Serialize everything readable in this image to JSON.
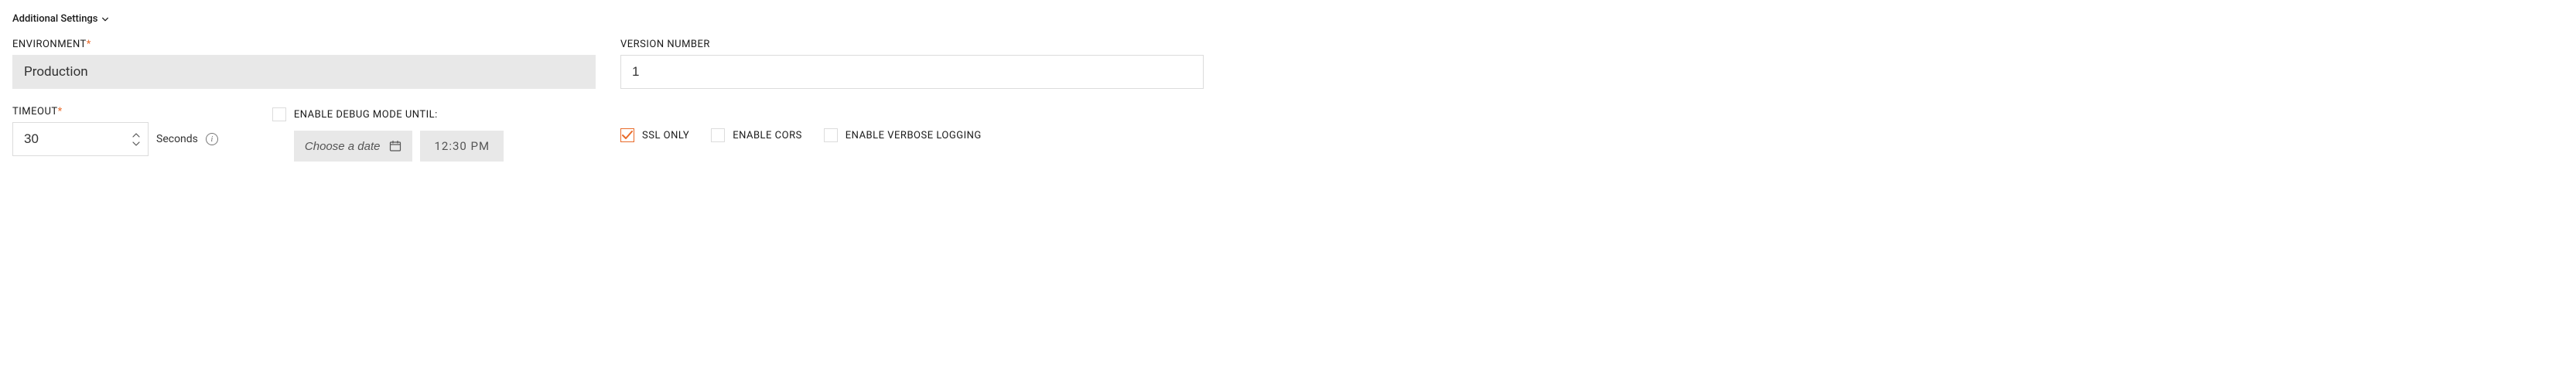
{
  "section": {
    "title": "Additional Settings"
  },
  "environment": {
    "label": "ENVIRONMENT",
    "required": "*",
    "value": "Production"
  },
  "versionNumber": {
    "label": "VERSION NUMBER",
    "value": "1"
  },
  "timeout": {
    "label": "TIMEOUT",
    "required": "*",
    "value": "30",
    "unit": "Seconds"
  },
  "debugMode": {
    "checkboxLabel": "ENABLE DEBUG MODE UNTIL:",
    "datePlaceholder": "Choose a date",
    "time": "12:30 PM"
  },
  "options": {
    "sslOnly": {
      "label": "SSL ONLY",
      "checked": true
    },
    "enableCors": {
      "label": "ENABLE CORS",
      "checked": false
    },
    "enableVerboseLogging": {
      "label": "ENABLE VERBOSE LOGGING",
      "checked": false
    }
  }
}
